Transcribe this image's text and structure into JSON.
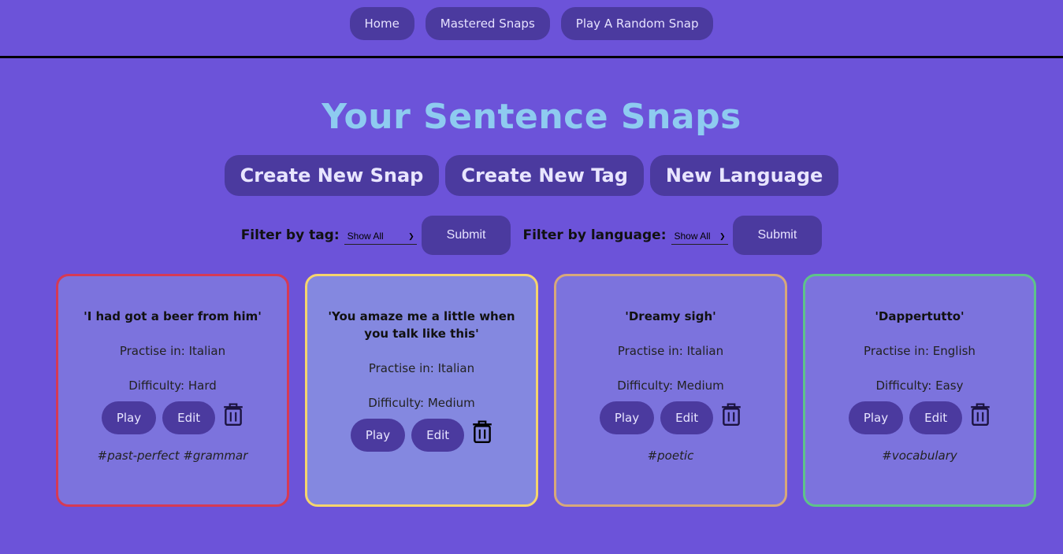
{
  "nav": {
    "items": [
      {
        "label": "Home"
      },
      {
        "label": "Mastered Snaps"
      },
      {
        "label": "Play A Random Snap"
      }
    ]
  },
  "page_title": "Your Sentence Snaps",
  "actions": {
    "create_snap": "Create New Snap",
    "create_tag": "Create New Tag",
    "new_language": "New Language"
  },
  "filters": {
    "tag_label": "Filter by tag:",
    "tag_value": "Show All",
    "language_label": "Filter by language:",
    "language_value": "Show All",
    "submit_label": "Submit"
  },
  "cards": [
    {
      "sentence": "'I had got a beer from him'",
      "practise": "Practise in: Italian",
      "difficulty": "Difficulty: Hard",
      "play": "Play",
      "edit": "Edit",
      "tags": "#past-perfect #grammar",
      "border_color": "#d53a55",
      "background": "#7c73dd"
    },
    {
      "sentence": "'You amaze me a little when you talk like this'",
      "practise": "Practise in: Italian",
      "difficulty": "Difficulty: Medium",
      "play": "Play",
      "edit": "Edit",
      "tags": "",
      "border_color": "#f5d56d",
      "background": "#8488e0"
    },
    {
      "sentence": "'Dreamy sigh'",
      "practise": "Practise in: Italian",
      "difficulty": "Difficulty: Medium",
      "play": "Play",
      "edit": "Edit",
      "tags": "#poetic",
      "border_color": "#d7a87a",
      "background": "#7c73dd"
    },
    {
      "sentence": "'Dappertutto'",
      "practise": "Practise in: English",
      "difficulty": "Difficulty: Easy",
      "play": "Play",
      "edit": "Edit",
      "tags": "#vocabulary",
      "border_color": "#5ec38a",
      "background": "#7c73dd"
    }
  ],
  "icons": {
    "trash": "trash-icon",
    "select_chevron": "chevron-down-icon"
  }
}
